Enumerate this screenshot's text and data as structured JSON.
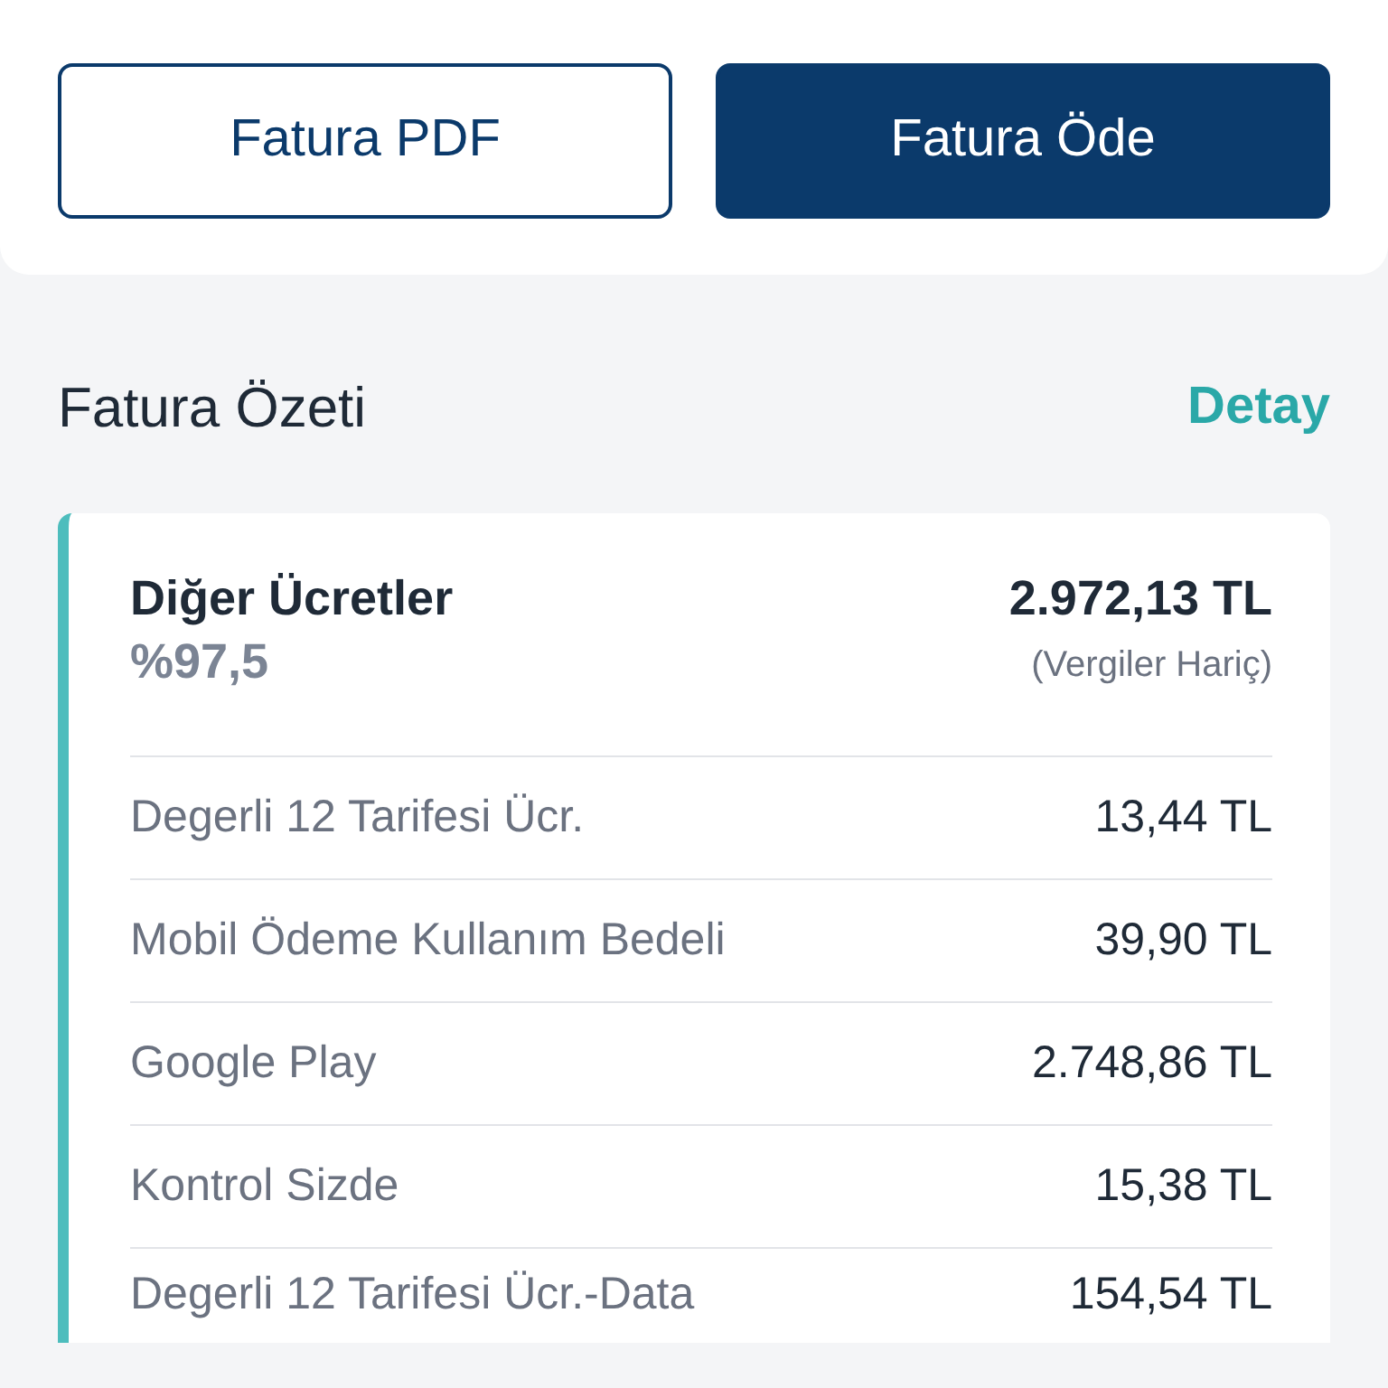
{
  "buttons": [
    {
      "label": "Fatura PDF",
      "kind": "outline"
    },
    {
      "label": "Fatura Öde",
      "kind": "filled"
    }
  ],
  "summary": {
    "title": "Fatura Özeti",
    "link": "Detay",
    "card": {
      "title": "Diğer Ücretler",
      "percent": "%97,5",
      "total": "2.972,13 TL",
      "note": "(Vergiler Hariç)",
      "rows": [
        {
          "label": "Degerli 12 Tarifesi Ücr.",
          "amount": "13,44 TL"
        },
        {
          "label": "Mobil Ödeme Kullanım Bedeli",
          "amount": "39,90 TL"
        },
        {
          "label": "Google Play",
          "amount": "2.748,86 TL"
        },
        {
          "label": "Kontrol Sizde",
          "amount": "15,38 TL"
        },
        {
          "label": "Degerli 12 Tarifesi Ücr.-Data",
          "amount": "154,54 TL"
        }
      ]
    }
  }
}
